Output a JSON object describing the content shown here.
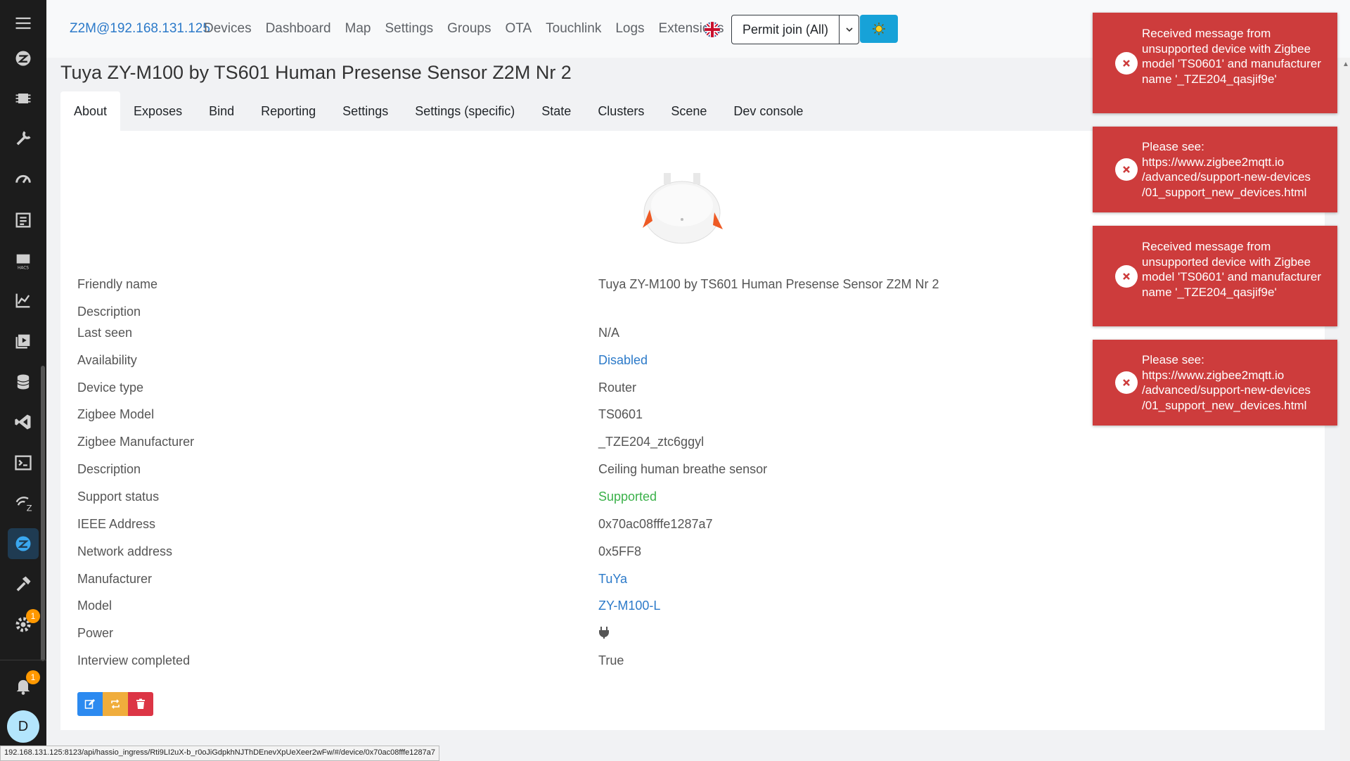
{
  "sidebar": {
    "items": [
      {
        "name": "menu-icon"
      },
      {
        "name": "zigbee-icon"
      },
      {
        "name": "chip-icon"
      },
      {
        "name": "wrench-icon"
      },
      {
        "name": "speedometer-icon"
      },
      {
        "name": "list-icon"
      },
      {
        "name": "hacs-icon"
      },
      {
        "name": "chart-icon"
      },
      {
        "name": "media-icon"
      },
      {
        "name": "database-icon"
      },
      {
        "name": "vscode-icon"
      },
      {
        "name": "terminal-icon"
      },
      {
        "name": "zwave-icon"
      },
      {
        "name": "z2m-icon"
      },
      {
        "name": "hammer-icon"
      },
      {
        "name": "settings-icon"
      },
      {
        "name": "bell-icon"
      }
    ],
    "settings_badge": "1",
    "notifications_badge": "1",
    "avatar_initial": "D"
  },
  "navbar": {
    "brand": "Z2M@192.168.131.125",
    "links": [
      "Devices",
      "Dashboard",
      "Map",
      "Settings",
      "Groups",
      "OTA",
      "Touchlink",
      "Logs",
      "Extensions"
    ],
    "permit_join": "Permit join (All)",
    "flag_icon": "uk-flag-icon",
    "theme_icon": "sun-icon"
  },
  "page": {
    "title": "Tuya ZY-M100 by TS601 Human Presense Sensor Z2M Nr 2",
    "tabs": [
      "About",
      "Exposes",
      "Bind",
      "Reporting",
      "Settings",
      "Settings (specific)",
      "State",
      "Clusters",
      "Scene",
      "Dev console"
    ],
    "active_tab": "About"
  },
  "device_info": [
    {
      "key": "Friendly name",
      "value": "Tuya ZY-M100 by TS601 Human Presense Sensor Z2M Nr 2",
      "style": "plain"
    },
    {
      "key": "Description",
      "value": "",
      "style": "plain"
    },
    {
      "key": "Last seen",
      "value": "N/A",
      "style": "plain"
    },
    {
      "key": "Availability",
      "value": "Disabled",
      "style": "link"
    },
    {
      "key": "Device type",
      "value": "Router",
      "style": "plain"
    },
    {
      "key": "Zigbee Model",
      "value": "TS0601",
      "style": "plain"
    },
    {
      "key": "Zigbee Manufacturer",
      "value": "_TZE204_ztc6ggyl",
      "style": "plain"
    },
    {
      "key": "Description",
      "value": "Ceiling human breathe sensor",
      "style": "plain"
    },
    {
      "key": "Support status",
      "value": "Supported",
      "style": "ok"
    },
    {
      "key": "IEEE Address",
      "value": "0x70ac08fffe1287a7",
      "style": "plain"
    },
    {
      "key": "Network address",
      "value": "0x5FF8",
      "style": "plain"
    },
    {
      "key": "Manufacturer",
      "value": "TuYa",
      "style": "link"
    },
    {
      "key": "Model",
      "value": "ZY-M100-L",
      "style": "link"
    },
    {
      "key": "Power",
      "value": "",
      "style": "icon",
      "icon": "plug-icon"
    },
    {
      "key": "Interview completed",
      "value": "True",
      "style": "plain"
    }
  ],
  "actions": [
    {
      "name": "edit-button",
      "icon": "edit-icon",
      "color": "#2c8af0"
    },
    {
      "name": "rename-button",
      "icon": "swap-icon",
      "color": "#f0ad3c"
    },
    {
      "name": "delete-button",
      "icon": "trash-icon",
      "color": "#dc3545"
    }
  ],
  "toasts": [
    {
      "text": "Received message from unsupported device with Zigbee model 'TS0601' and manufacturer name '_TZE204_qasjif9e'"
    },
    {
      "text": "Please see: https://www.zigbee2mqtt.io /advanced/support-new-devices /01_support_new_devices.html"
    },
    {
      "text": "Received message from unsupported device with Zigbee model 'TS0601' and manufacturer name '_TZE204_qasjif9e'"
    },
    {
      "text": "Please see: https://www.zigbee2mqtt.io /advanced/support-new-devices /01_support_new_devices.html"
    }
  ],
  "status_url": "192.168.131.125:8123/api/hassio_ingress/Rti9LI2uX-b_r0oJiGdpkhNJThDEnevXpUeXeer2wFw/#/device/0x70ac08fffe1287a7",
  "colors": {
    "toast_bg": "#cd3c3c",
    "link": "#2c7ac9",
    "supported": "#3bb14a",
    "sidebar_bg": "#1c1c1c",
    "theme_button": "#17a2d8"
  }
}
